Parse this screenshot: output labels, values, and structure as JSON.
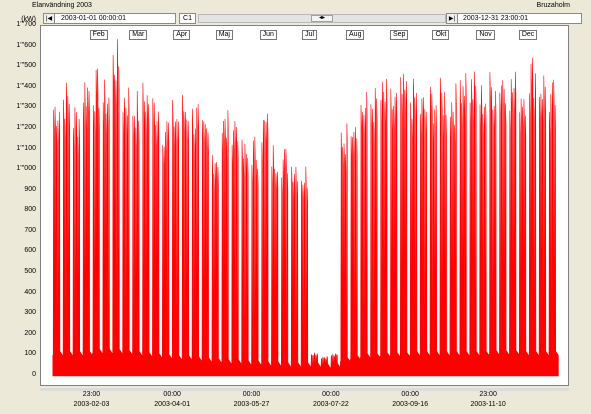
{
  "window": {
    "title": "Elanvändning 2003",
    "site": "Bruzaholm"
  },
  "nav": {
    "first_btn": "|◀",
    "start_datetime": "2003-01-01 00:00:01",
    "channel": "C1",
    "scroll_thumb": "◂▸",
    "last_btn": "▶|",
    "end_datetime": "2003-12-31 23:00:01"
  },
  "axis": {
    "unit": "(kW)",
    "y_ticks": [
      "1'''700",
      "1'''600",
      "1'''500",
      "1'''400",
      "1'''300",
      "1'''200",
      "1'''100",
      "1'''000",
      "900",
      "800",
      "700",
      "600",
      "500",
      "400",
      "300",
      "200",
      "100",
      "0"
    ]
  },
  "months": [
    "Feb",
    "Mar",
    "Apr",
    "Maj",
    "Jun",
    "Jul",
    "Aug",
    "Sep",
    "Okt",
    "Nov",
    "Dec"
  ],
  "x_ticks": [
    {
      "time": "23:00",
      "date": "2003-02-03"
    },
    {
      "time": "00:00",
      "date": "2003-04-01"
    },
    {
      "time": "00:00",
      "date": "2003-05-27"
    },
    {
      "time": "00:00",
      "date": "2003-07-22"
    },
    {
      "time": "00:00",
      "date": "2003-09-16"
    },
    {
      "time": "23:00",
      "date": "2003-11-10"
    }
  ],
  "chart_data": {
    "type": "area",
    "title": "Elanvändning 2003",
    "ylabel": "(kW)",
    "ylim": [
      0,
      1700
    ],
    "xlim": [
      "2003-01-01",
      "2003-12-31"
    ],
    "series_color": "#ff0000",
    "series": [
      {
        "x": [
          "2003-01-06",
          "2003-01-13",
          "2003-01-20",
          "2003-01-27",
          "2003-02-03",
          "2003-02-10",
          "2003-02-17",
          "2003-02-24",
          "2003-03-03",
          "2003-03-10",
          "2003-03-17",
          "2003-03-24",
          "2003-03-31",
          "2003-04-07",
          "2003-04-14",
          "2003-04-21",
          "2003-04-28",
          "2003-05-05",
          "2003-05-12",
          "2003-05-19",
          "2003-05-26",
          "2003-06-02",
          "2003-06-09",
          "2003-06-16",
          "2003-06-23",
          "2003-06-30",
          "2003-07-07",
          "2003-07-14",
          "2003-07-21",
          "2003-07-28",
          "2003-08-04",
          "2003-08-11",
          "2003-08-18",
          "2003-08-25",
          "2003-09-01",
          "2003-09-08",
          "2003-09-15",
          "2003-09-22",
          "2003-09-29",
          "2003-10-06",
          "2003-10-13",
          "2003-10-20",
          "2003-10-27",
          "2003-11-03",
          "2003-11-10",
          "2003-11-17",
          "2003-11-24",
          "2003-12-01",
          "2003-12-08",
          "2003-12-15",
          "2003-12-22"
        ],
        "weekday_peak": [
          1400,
          1450,
          1350,
          1500,
          1500,
          1450,
          1640,
          1450,
          1400,
          1450,
          1400,
          1300,
          1350,
          1400,
          1350,
          1250,
          1150,
          1300,
          1320,
          1150,
          1180,
          1300,
          1150,
          1130,
          1100,
          1050,
          120,
          100,
          110,
          1250,
          1350,
          1400,
          1420,
          1450,
          1420,
          1470,
          1450,
          1400,
          1430,
          1450,
          1430,
          1550,
          1500,
          1450,
          1500,
          1550,
          1500,
          1480,
          1580,
          1520,
          1450
        ],
        "base_load": [
          100,
          100,
          100,
          100,
          110,
          110,
          110,
          105,
          100,
          95,
          90,
          85,
          80,
          80,
          75,
          70,
          65,
          60,
          60,
          55,
          55,
          50,
          50,
          45,
          45,
          45,
          45,
          40,
          40,
          70,
          80,
          90,
          90,
          95,
          95,
          95,
          100,
          100,
          100,
          100,
          100,
          100,
          100,
          100,
          105,
          105,
          105,
          100,
          100,
          100,
          100
        ]
      }
    ]
  }
}
